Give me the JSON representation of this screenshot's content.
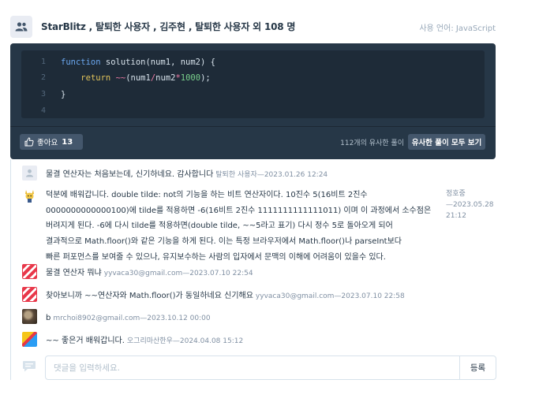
{
  "header": {
    "icon": "group-icon",
    "title": "StarBlitz , 탈퇴한 사용자 , 김주현 , 탈퇴한 사용자 외 108 명",
    "language_label": "사용 언어: JavaScript"
  },
  "code": {
    "lines": [
      {
        "no": "1",
        "parts": [
          [
            "kw",
            "function"
          ],
          [
            "plain",
            " solution(num1, num2) {"
          ]
        ]
      },
      {
        "no": "2",
        "parts": [
          [
            "plain",
            "    "
          ],
          [
            "rt",
            "return"
          ],
          [
            "plain",
            " "
          ],
          [
            "op",
            "~~"
          ],
          [
            "plain",
            "(num1"
          ],
          [
            "op",
            "/"
          ],
          [
            "plain",
            "num2"
          ],
          [
            "op",
            "*"
          ],
          [
            "num",
            "1000"
          ],
          [
            "plain",
            ");"
          ]
        ]
      },
      {
        "no": "3",
        "parts": [
          [
            "plain",
            "}"
          ]
        ]
      },
      {
        "no": "4",
        "parts": []
      }
    ]
  },
  "actions": {
    "like_label": "좋아요",
    "like_count": "13",
    "similar_text": "112개의 유사한 풀이",
    "view_all_label": "유사한 풀이 모두 보기"
  },
  "comments": [
    {
      "avatar": "default",
      "text": "물결 연산자는 처음보는데, 신기하네요. 감사합니다",
      "meta": "탈퇴한 사용자—2023.01.26 12:24"
    },
    {
      "avatar": "pokemon",
      "lines": [
        "덕분에 배워갑니다. double tilde: not의 기능을 하는 비트 연산자이다. 10진수 5(16비트 2진수",
        "0000000000000100)에 tilde를 적용하면 -6(16비트 2진수 1111111111111011) 이며 이 과정에서 소수점은",
        "버려지게 된다. -6에 다시 tilde를 적용하면(double tilde, ~~5라고 표기) 다시 정수 5로 돌아오게 되어",
        "결과적으로 Math.floor()와 같은 기능을 하게 된다. 이는 특정 브라우저에서 Math.floor()나 parseInt보다",
        "빠른 퍼포먼스를 보여줄 수 있으나, 유지보수하는 사람의 입자에서 문맥의 이해에 어려움이 있을수 있다."
      ],
      "meta_lines": [
        "정호중",
        "—2023.05.28",
        "21:12"
      ]
    },
    {
      "avatar": "stripe",
      "text": "물결 연산자 뭐냐",
      "meta": "yyvaca30@gmail.com—2023.07.10 22:54"
    },
    {
      "avatar": "stripe",
      "text": "찾아보니까 ~~연산자와 Math.floor()가 동일하네요 신기해요",
      "meta": "yyvaca30@gmail.com—2023.07.10 22:58"
    },
    {
      "avatar": "photo",
      "text": "b",
      "meta": "mrchoi8902@gmail.com—2023.10.12 00:00"
    },
    {
      "avatar": "colorful",
      "text": "~~ 좋은거 배워갑니다.",
      "meta": "오그리마산한우—2024.04.08 15:12"
    }
  ],
  "comment_form": {
    "placeholder": "댓글을 입력하세요.",
    "submit_label": "등록"
  },
  "colors": {
    "code_card": "#263747",
    "code_box": "#1e2b38",
    "button": "#44576c",
    "accent_stripe": "#e8384a"
  }
}
